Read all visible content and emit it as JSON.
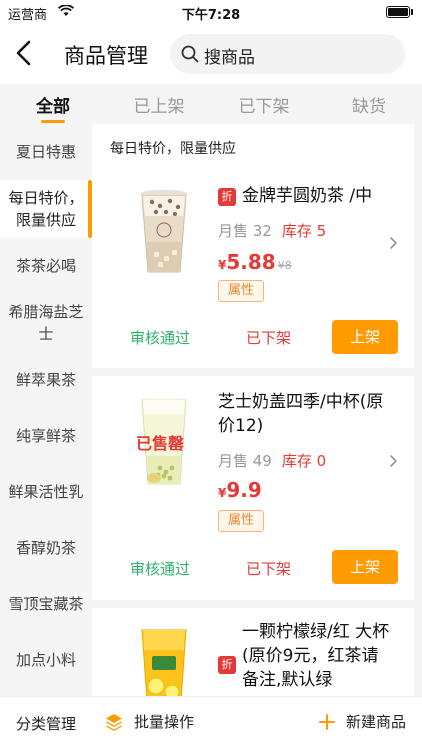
{
  "status_bar": {
    "carrier": "运营商",
    "time": "下午7:28"
  },
  "nav": {
    "title": "商品管理",
    "search_placeholder": "搜商品"
  },
  "tabs": [
    {
      "label": "全部",
      "active": true
    },
    {
      "label": "已上架"
    },
    {
      "label": "已下架"
    },
    {
      "label": "缺货"
    }
  ],
  "categories": [
    {
      "label": "夏日特惠"
    },
    {
      "label": "每日特价，限量供应",
      "active": true
    },
    {
      "label": "茶茶必喝"
    },
    {
      "label": "希腊海盐芝士"
    },
    {
      "label": "鲜萃果茶"
    },
    {
      "label": "纯享鲜茶"
    },
    {
      "label": "鲜果活性乳"
    },
    {
      "label": "香醇奶茶"
    },
    {
      "label": "雪顶宝藏茶"
    },
    {
      "label": "加点小料"
    }
  ],
  "section_title": "每日特价，限量供应",
  "products": [
    {
      "badge": "折",
      "name": "金牌芋圆奶茶 /中",
      "sales_label": "月售 32",
      "stock_label": "库存 5",
      "currency": "¥",
      "price": "5.88",
      "original_price": "¥8",
      "attr": "属性",
      "audit": "审核通过",
      "status": "已下架",
      "action": "上架"
    },
    {
      "sold_out": "已售罄",
      "name": "芝士奶盖四季/中杯(原价12)",
      "sales_label": "月售 49",
      "stock_label": "库存 0",
      "currency": "¥",
      "price": "9.9",
      "attr": "属性",
      "audit": "审核通过",
      "status": "已下架",
      "action": "上架"
    },
    {
      "badge": "折",
      "name": "一颗柠檬绿/红 大杯 (原价9元，红茶请备注,默认绿"
    }
  ],
  "bottom_bar": {
    "category_manage": "分类管理",
    "batch_ops": "批量操作",
    "new_product": "新建商品"
  },
  "colors": {
    "accent": "#ff9b00",
    "danger": "#e53935",
    "success": "#2db36a"
  },
  "icons": [
    "wifi-icon",
    "battery-icon",
    "back-icon",
    "search-icon",
    "chevron-right-icon",
    "layers-icon",
    "plus-icon"
  ]
}
